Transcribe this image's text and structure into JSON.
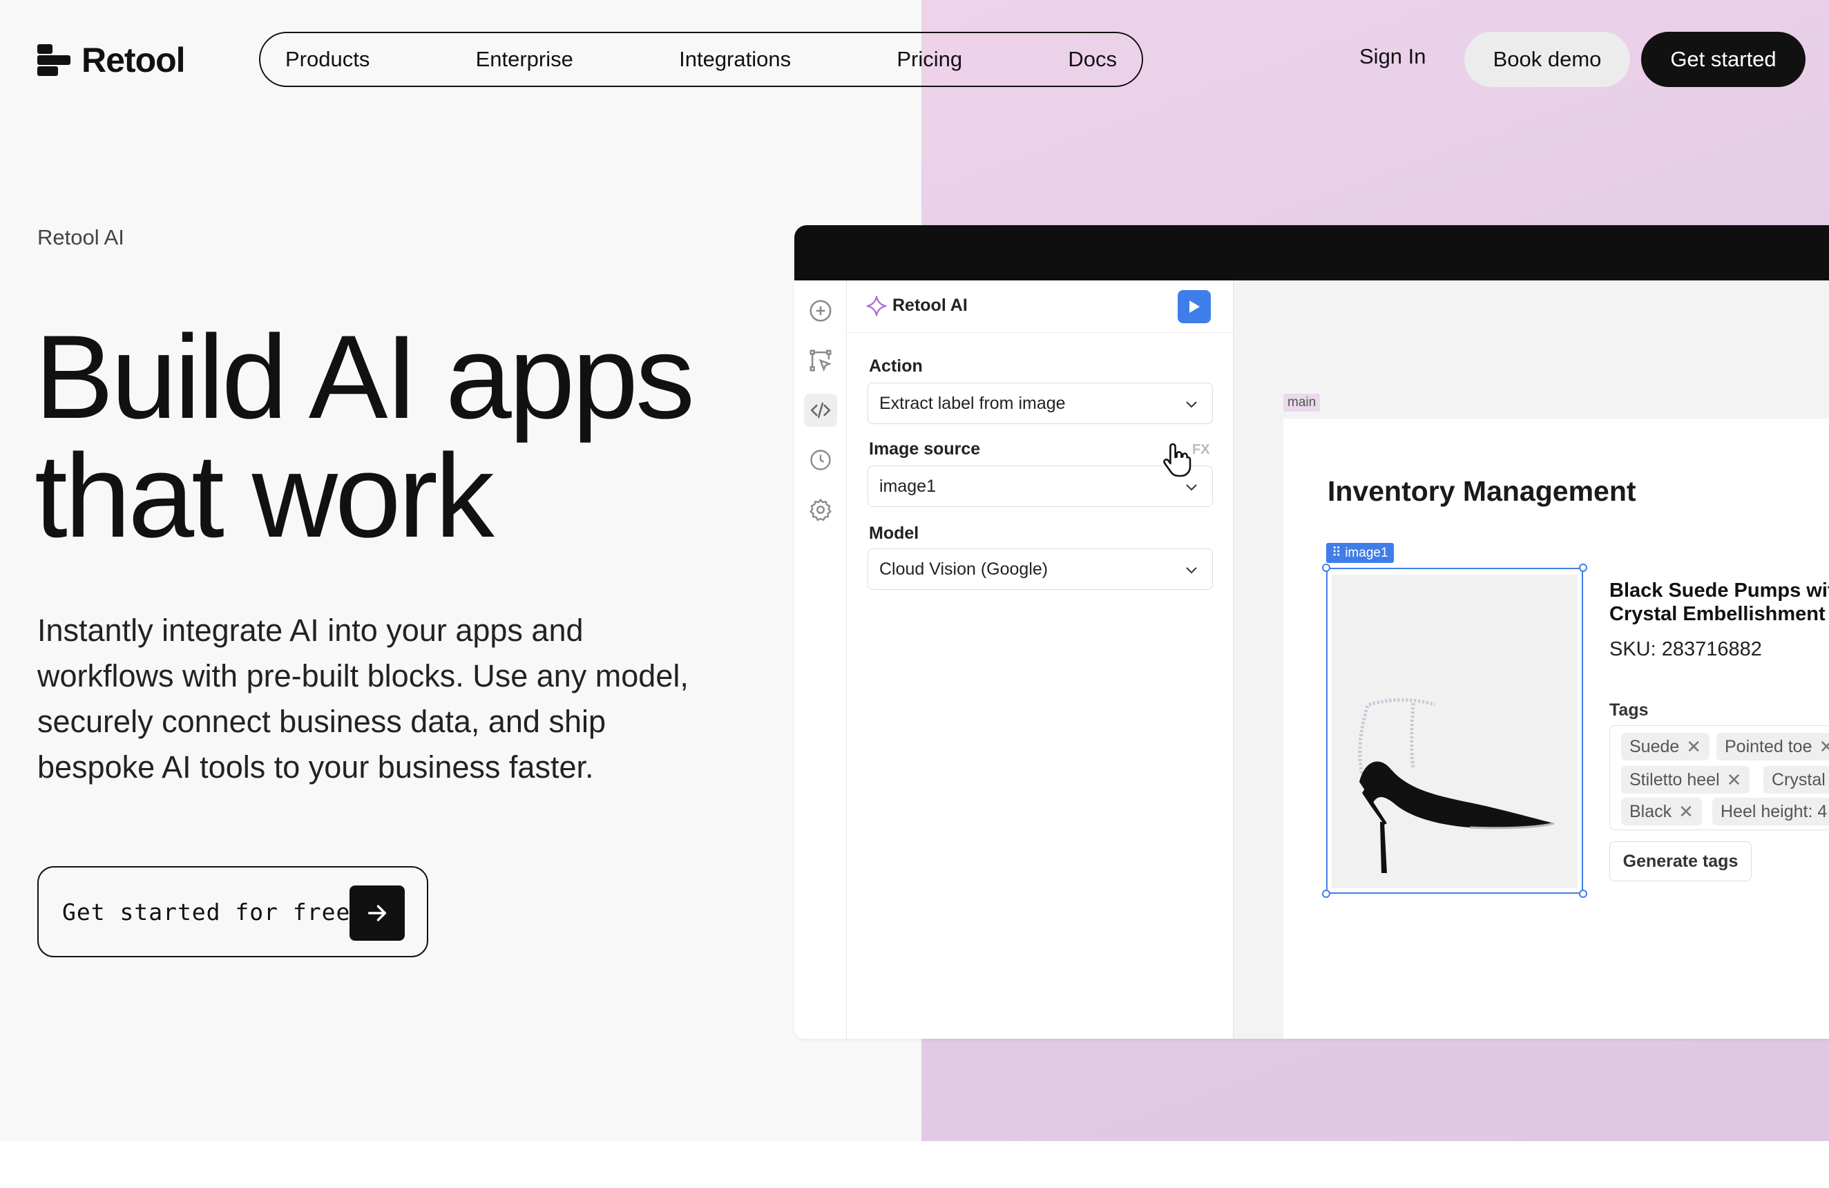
{
  "brand": {
    "name": "Retool"
  },
  "nav": {
    "items": [
      "Products",
      "Enterprise",
      "Integrations",
      "Pricing",
      "Docs"
    ],
    "sign_in": "Sign In",
    "book_demo": "Book demo",
    "get_started": "Get started"
  },
  "hero": {
    "eyebrow": "Retool AI",
    "title_line1": "Build AI apps",
    "title_line2": "that work",
    "subtitle": "Instantly integrate AI into your apps and workflows with pre-built blocks. Use any model, securely connect business data, and ship bespoke AI tools to your business faster.",
    "cta_label": "Get started for free"
  },
  "editor": {
    "panel_title": "Retool AI",
    "fields": [
      {
        "label": "Action",
        "value": "Extract label from image"
      },
      {
        "label": "Image source",
        "value": "image1"
      },
      {
        "label": "Model",
        "value": "Cloud Vision (Google)"
      }
    ],
    "fx_label": "FX",
    "rail_icons": [
      "plus-circle-icon",
      "selection-icon",
      "code-icon",
      "history-icon",
      "settings-icon"
    ]
  },
  "canvas": {
    "container_tag": "main",
    "app_title": "Inventory Management",
    "image_tag": "image1",
    "product": {
      "name_line1": "Black Suede Pumps with",
      "name_line2": "Crystal Embellishment",
      "sku": "SKU: 283716882"
    },
    "tags_label": "Tags",
    "tags": [
      "Suede",
      "Pointed toe",
      "Stiletto heel",
      "Crystal",
      "Black",
      "Heel height: 4"
    ],
    "generate_button": "Generate tags"
  },
  "colors": {
    "accent_blue": "#3f7ee8",
    "purple_bg": "#e5cde6",
    "dark": "#111111"
  }
}
